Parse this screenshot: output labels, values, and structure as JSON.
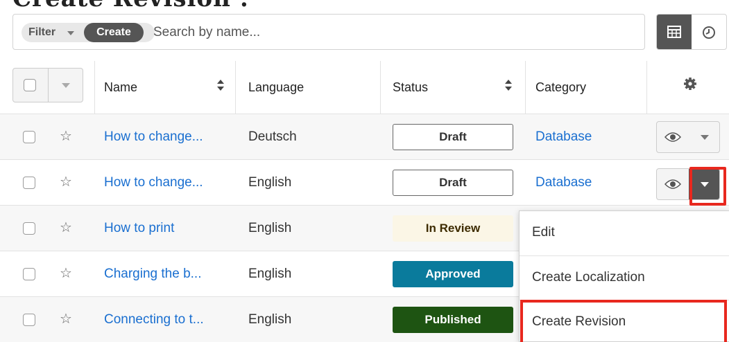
{
  "heading": "Create Revision :",
  "toolbar": {
    "filter_label": "Filter",
    "create_label": "Create",
    "search_placeholder": "Search by name...",
    "view_options": [
      "list-view-icon",
      "activity-stream-icon"
    ],
    "active_view": "list-view-icon"
  },
  "table": {
    "columns": [
      "Name",
      "Language",
      "Status",
      "Category"
    ],
    "rows": [
      {
        "name": "How to change...",
        "language": "Deutsch",
        "status": "Draft",
        "category": "Database"
      },
      {
        "name": "How to change...",
        "language": "English",
        "status": "Draft",
        "category": "Database"
      },
      {
        "name": "How to print",
        "language": "English",
        "status": "In Review",
        "category": ""
      },
      {
        "name": "Charging the b...",
        "language": "English",
        "status": "Approved",
        "category": ""
      },
      {
        "name": "Connecting to t...",
        "language": "English",
        "status": "Published",
        "category": ""
      }
    ]
  },
  "dropdown": {
    "items": [
      "Edit",
      "Create Localization",
      "Create Revision"
    ],
    "highlighted": "Create Revision"
  },
  "colors": {
    "link": "#1a6fd0",
    "highlight": "#e8281e",
    "approved": "#0a7b9c",
    "published": "#1e5412",
    "in_review": "#fbf6e6"
  }
}
